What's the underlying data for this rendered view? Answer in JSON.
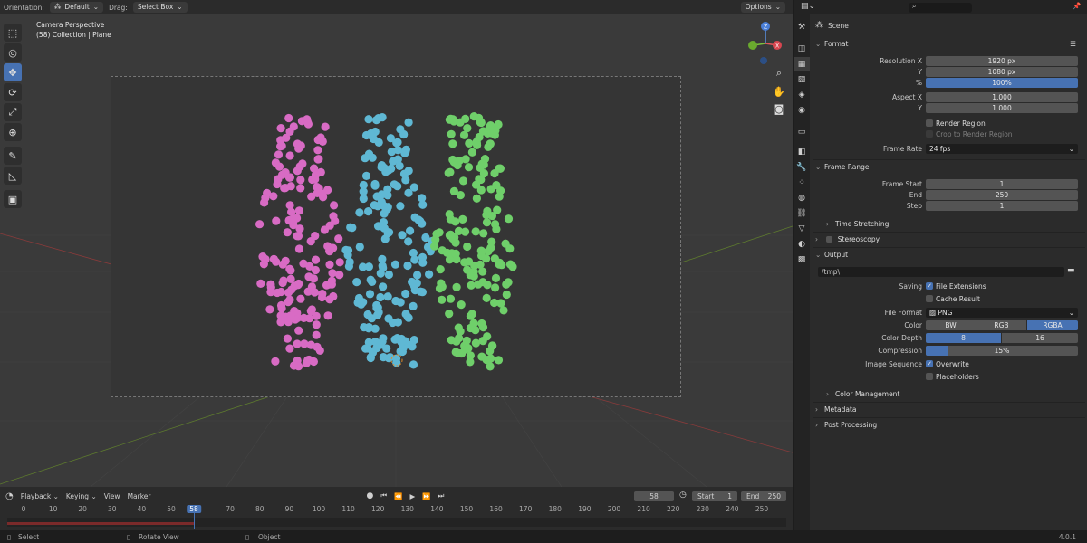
{
  "viewport": {
    "orientation_label": "Orientation:",
    "orientation_value": "Default",
    "drag_label": "Drag:",
    "drag_value": "Select Box",
    "options_label": "Options",
    "view_name": "Camera Perspective",
    "collection_info": "(58) Collection | Plane",
    "tools": [
      "select-box-icon",
      "cursor-icon",
      "move-icon",
      "rotate-icon",
      "scale-icon",
      "transform-icon",
      "annotate-icon",
      "measure-icon",
      "add-cube-icon"
    ]
  },
  "colors": {
    "pink": "#d86bc4",
    "cyan": "#5fb8d4",
    "green": "#6fcf6a",
    "accent": "#4772b3"
  },
  "timeline": {
    "playback": "Playback",
    "keying": "Keying",
    "view": "View",
    "marker": "Marker",
    "current_frame": "58",
    "start_label": "Start",
    "start_value": "1",
    "end_label": "End",
    "end_value": "250",
    "ticks": [
      "0",
      "10",
      "20",
      "30",
      "40",
      "50",
      "58",
      "70",
      "80",
      "90",
      "100",
      "110",
      "120",
      "130",
      "140",
      "150",
      "160",
      "170",
      "180",
      "190",
      "200",
      "210",
      "220",
      "230",
      "240",
      "250"
    ]
  },
  "status": {
    "select": "Select",
    "rotate": "Rotate View",
    "object": "Object",
    "version": "4.0.1"
  },
  "properties": {
    "scene_label": "Scene",
    "format": {
      "title": "Format",
      "res_x_label": "Resolution X",
      "res_x": "1920 px",
      "res_y_label": "Y",
      "res_y": "1080 px",
      "percent_label": "%",
      "percent": "100%",
      "aspect_x_label": "Aspect X",
      "aspect_x": "1.000",
      "aspect_y_label": "Y",
      "aspect_y": "1.000",
      "render_region": "Render Region",
      "crop": "Crop to Render Region",
      "frame_rate_label": "Frame Rate",
      "frame_rate": "24 fps"
    },
    "frame_range": {
      "title": "Frame Range",
      "start_label": "Frame Start",
      "start": "1",
      "end_label": "End",
      "end": "250",
      "step_label": "Step",
      "step": "1",
      "time_stretching": "Time Stretching"
    },
    "stereoscopy": "Stereoscopy",
    "output": {
      "title": "Output",
      "path": "/tmp\\",
      "saving_label": "Saving",
      "file_ext": "File Extensions",
      "cache": "Cache Result",
      "file_format_label": "File Format",
      "file_format": "PNG",
      "color_label": "Color",
      "color_bw": "BW",
      "color_rgb": "RGB",
      "color_rgba": "RGBA",
      "depth_label": "Color Depth",
      "depth_8": "8",
      "depth_16": "16",
      "compression_label": "Compression",
      "compression": "15%",
      "compression_fraction": 0.15,
      "image_seq_label": "Image Sequence",
      "overwrite": "Overwrite",
      "placeholders": "Placeholders",
      "color_management": "Color Management"
    },
    "metadata": "Metadata",
    "post_processing": "Post Processing"
  }
}
